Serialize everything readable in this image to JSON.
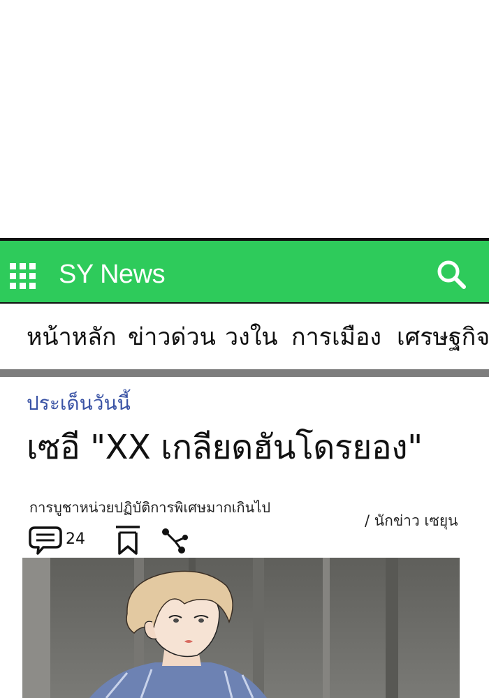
{
  "app": {
    "brand": "SY News",
    "accent_color": "#2ecb5b",
    "icons": [
      "grid-menu-icon",
      "search-icon",
      "comment-icon",
      "bookmark-icon",
      "share-icon"
    ]
  },
  "nav": {
    "items": [
      {
        "label": "หน้าหลัก"
      },
      {
        "label": "ข่าวด่วน"
      },
      {
        "label": "วงใน"
      },
      {
        "label": "การเมือง"
      },
      {
        "label": "เศรษฐกิจ"
      }
    ]
  },
  "article": {
    "kicker": "ประเด็นวันนี้",
    "headline": "เซอี \"XX เกลียดฮันโดรยอง\"",
    "subhead": "การบูชาหน่วยปฏิบัติการพิเศษมากเกินไป",
    "byline": "/ นักข่าว เซยุน",
    "comment_count": "24"
  }
}
